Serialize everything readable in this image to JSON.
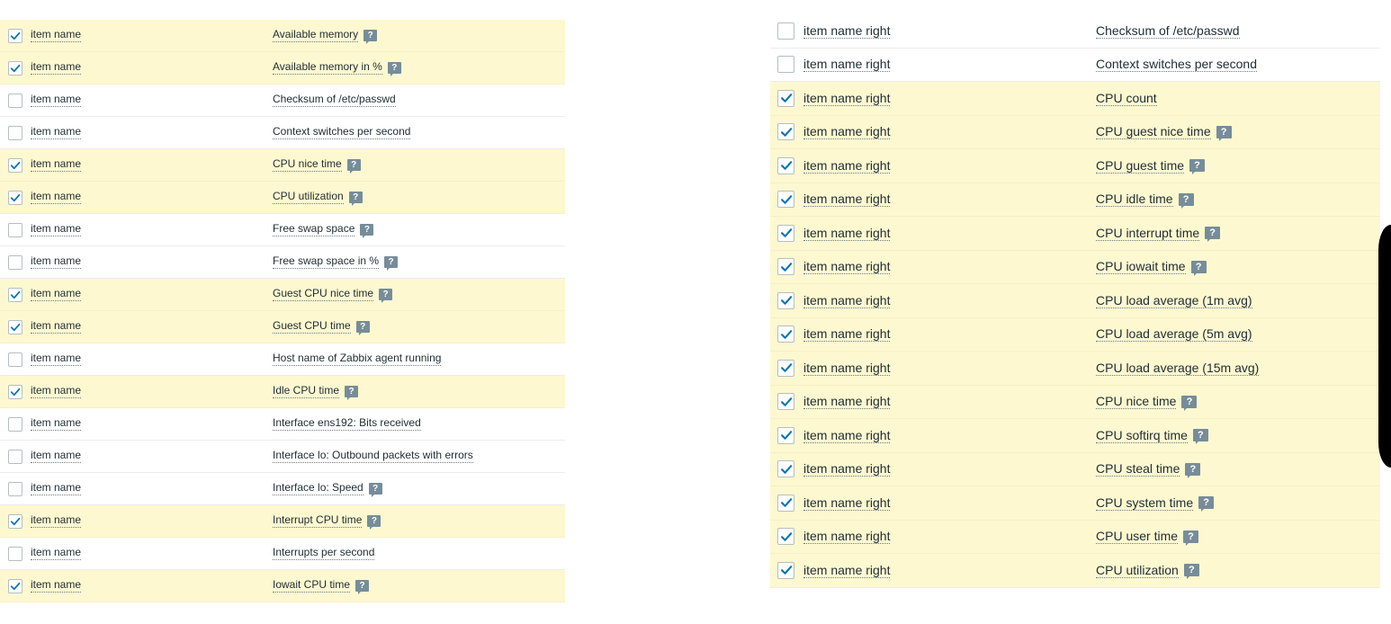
{
  "left_list": {
    "rows": [
      {
        "checked": true,
        "name": "item name",
        "description": "Available memory",
        "has_help": true
      },
      {
        "checked": true,
        "name": "item name",
        "description": "Available memory in %",
        "has_help": true
      },
      {
        "checked": false,
        "name": "item name",
        "description": "Checksum of /etc/passwd",
        "has_help": false
      },
      {
        "checked": false,
        "name": "item name",
        "description": "Context switches per second",
        "has_help": false
      },
      {
        "checked": true,
        "name": "item name",
        "description": "CPU nice time",
        "has_help": true
      },
      {
        "checked": true,
        "name": "item name",
        "description": "CPU utilization",
        "has_help": true
      },
      {
        "checked": false,
        "name": "item name",
        "description": "Free swap space",
        "has_help": true
      },
      {
        "checked": false,
        "name": "item name",
        "description": "Free swap space in %",
        "has_help": true
      },
      {
        "checked": true,
        "name": "item name",
        "description": "Guest CPU nice time",
        "has_help": true
      },
      {
        "checked": true,
        "name": "item name",
        "description": "Guest CPU time",
        "has_help": true
      },
      {
        "checked": false,
        "name": "item name",
        "description": "Host name of Zabbix agent running",
        "has_help": false
      },
      {
        "checked": true,
        "name": "item name",
        "description": "Idle CPU time",
        "has_help": true
      },
      {
        "checked": false,
        "name": "item name",
        "description": "Interface ens192: Bits received",
        "has_help": false
      },
      {
        "checked": false,
        "name": "item name",
        "description": "Interface lo: Outbound packets with errors",
        "has_help": false
      },
      {
        "checked": false,
        "name": "item name",
        "description": "Interface lo: Speed",
        "has_help": true
      },
      {
        "checked": true,
        "name": "item name",
        "description": "Interrupt CPU time",
        "has_help": true
      },
      {
        "checked": false,
        "name": "item name",
        "description": "Interrupts per second",
        "has_help": false
      },
      {
        "checked": true,
        "name": "item name",
        "description": "Iowait CPU time",
        "has_help": true
      }
    ]
  },
  "right_list": {
    "rows": [
      {
        "checked": false,
        "name": "item name right",
        "description": "Checksum of /etc/passwd",
        "has_help": false
      },
      {
        "checked": false,
        "name": "item name right",
        "description": "Context switches per second",
        "has_help": false
      },
      {
        "checked": true,
        "name": "item name right",
        "description": "CPU count",
        "has_help": false
      },
      {
        "checked": true,
        "name": "item name right",
        "description": "CPU guest nice time",
        "has_help": true
      },
      {
        "checked": true,
        "name": "item name right",
        "description": "CPU guest time",
        "has_help": true
      },
      {
        "checked": true,
        "name": "item name right",
        "description": "CPU idle time",
        "has_help": true
      },
      {
        "checked": true,
        "name": "item name right",
        "description": "CPU interrupt time",
        "has_help": true
      },
      {
        "checked": true,
        "name": "item name right",
        "description": "CPU iowait time",
        "has_help": true
      },
      {
        "checked": true,
        "name": "item name right",
        "description": "CPU load average (1m avg)",
        "has_help": false
      },
      {
        "checked": true,
        "name": "item name right",
        "description": "CPU load average (5m avg)",
        "has_help": false
      },
      {
        "checked": true,
        "name": "item name right",
        "description": "CPU load average (15m avg)",
        "has_help": false
      },
      {
        "checked": true,
        "name": "item name right",
        "description": "CPU nice time",
        "has_help": true
      },
      {
        "checked": true,
        "name": "item name right",
        "description": "CPU softirq time",
        "has_help": true
      },
      {
        "checked": true,
        "name": "item name right",
        "description": "CPU steal time",
        "has_help": true
      },
      {
        "checked": true,
        "name": "item name right",
        "description": "CPU system time",
        "has_help": true
      },
      {
        "checked": true,
        "name": "item name right",
        "description": "CPU user time",
        "has_help": true
      },
      {
        "checked": true,
        "name": "item name right",
        "description": "CPU utilization",
        "has_help": true
      }
    ]
  },
  "help_icon": {
    "glyph": "?",
    "name": "help-icon"
  },
  "colors": {
    "checked_row_bg": "#fdf8d0",
    "checkmark": "#0275b8",
    "help_badge": "#768d99"
  }
}
